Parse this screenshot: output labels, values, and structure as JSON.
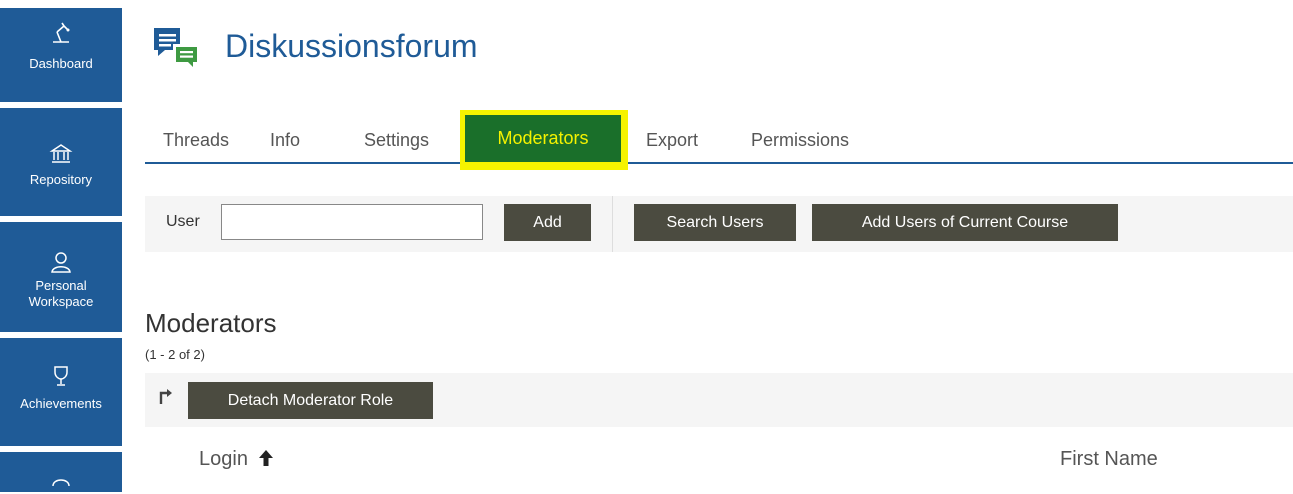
{
  "sidebar": {
    "items": [
      {
        "label": "Dashboard",
        "icon": "dashboard-icon"
      },
      {
        "label": "Repository",
        "icon": "repository-icon"
      },
      {
        "label": "Personal Workspace",
        "icon": "personal-workspace-icon"
      },
      {
        "label": "Achievements",
        "icon": "achievements-icon"
      },
      {
        "label": "",
        "icon": "communication-icon"
      }
    ],
    "color": "#1f5b97"
  },
  "header": {
    "title": "Diskussionsforum",
    "icon": "forum-icon"
  },
  "tabs": [
    {
      "label": "Threads"
    },
    {
      "label": "Info"
    },
    {
      "label": "Settings"
    },
    {
      "label": "Moderators",
      "active": true
    },
    {
      "label": "Export"
    },
    {
      "label": "Permissions"
    }
  ],
  "toolbar": {
    "user_label": "User",
    "user_value": "",
    "add_label": "Add",
    "search_users_label": "Search Users",
    "add_course_users_label": "Add Users of Current Course"
  },
  "moderators": {
    "title": "Moderators",
    "count": "(1 - 2 of 2)",
    "detach_label": "Detach Moderator Role",
    "columns": {
      "login": "Login",
      "first_name": "First Name"
    },
    "sort_indicator": "ascending"
  },
  "colors": {
    "accent": "#1f5b97",
    "active_tab_bg": "#1a6f2a",
    "active_tab_text": "#f4f200",
    "highlight": "#f6f300",
    "button": "#4b4b40"
  }
}
